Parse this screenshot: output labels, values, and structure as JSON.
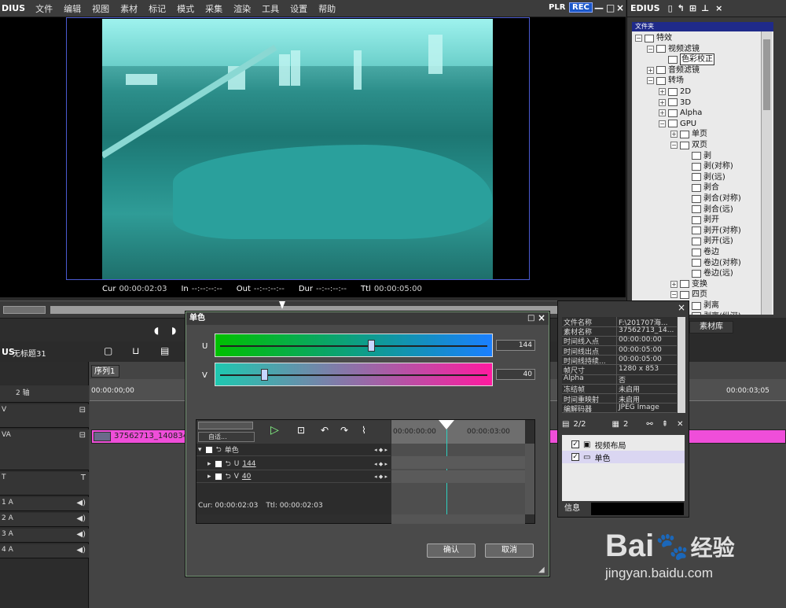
{
  "menu": {
    "logo": "DIUS",
    "items": [
      "文件",
      "编辑",
      "视图",
      "素材",
      "标记",
      "模式",
      "采集",
      "渲染",
      "工具",
      "设置",
      "帮助"
    ],
    "plr": "PLR",
    "rec": "REC"
  },
  "preview": {
    "timecodes": [
      {
        "key": "Cur",
        "value": "00:00:02:03"
      },
      {
        "key": "In",
        "value": "--:--:--:--"
      },
      {
        "key": "Out",
        "value": "--:--:--:--"
      },
      {
        "key": "Dur",
        "value": "--:--:--:--"
      },
      {
        "key": "Ttl",
        "value": "00:00:05:00"
      }
    ],
    "video_tint": "#2fa8a3"
  },
  "right_panel": {
    "title": "EDIUS",
    "folder_header": "文件夹",
    "tree": [
      {
        "label": "特效",
        "level": 0,
        "expanded": true
      },
      {
        "label": "视频滤镜",
        "level": 1,
        "expanded": true
      },
      {
        "label": "色彩校正",
        "level": 2,
        "selected": true
      },
      {
        "label": "音频滤镜",
        "level": 1
      },
      {
        "label": "转场",
        "level": 1,
        "expanded": true
      },
      {
        "label": "2D",
        "level": 2
      },
      {
        "label": "3D",
        "level": 2
      },
      {
        "label": "Alpha",
        "level": 2
      },
      {
        "label": "GPU",
        "level": 2,
        "expanded": true
      },
      {
        "label": "单页",
        "level": 3
      },
      {
        "label": "双页",
        "level": 3,
        "expanded": true
      },
      {
        "label": "剥",
        "level": 4
      },
      {
        "label": "剥(对称)",
        "level": 4
      },
      {
        "label": "剥(远)",
        "level": 4
      },
      {
        "label": "剥合",
        "level": 4
      },
      {
        "label": "剥合(对称)",
        "level": 4
      },
      {
        "label": "剥合(远)",
        "level": 4
      },
      {
        "label": "剥开",
        "level": 4
      },
      {
        "label": "剥开(对称)",
        "level": 4
      },
      {
        "label": "剥开(远)",
        "level": 4
      },
      {
        "label": "卷边",
        "level": 4
      },
      {
        "label": "卷边(对称)",
        "level": 4
      },
      {
        "label": "卷边(远)",
        "level": 4
      },
      {
        "label": "变换",
        "level": 3
      },
      {
        "label": "四页",
        "level": 3,
        "expanded": true
      },
      {
        "label": "剥离",
        "level": 4
      },
      {
        "label": "剥离(纵深)",
        "level": 4
      }
    ],
    "tab": "素材库"
  },
  "timeline": {
    "project": "无标题31",
    "sequence_tab": "序列1",
    "ruler": [
      "00:00:00;00",
      "00:00:03;05"
    ],
    "clip_label": "37562713_1408345",
    "tracks": [
      {
        "label": "2 轴"
      },
      {
        "label": "V"
      },
      {
        "label": "VA"
      },
      {
        "label": "T"
      },
      {
        "label": "1 A"
      },
      {
        "label": "2 A"
      },
      {
        "label": "3 A"
      },
      {
        "label": "4 A"
      }
    ]
  },
  "dialog": {
    "title": "单色",
    "u_label": "U",
    "u_value": 144,
    "v_label": "V",
    "v_value": 40,
    "kf_dropdown": "自适...",
    "kf_ruler": [
      "00:00:00:00",
      "00:00:03:00"
    ],
    "kf_rows": [
      {
        "label": "单色"
      },
      {
        "label": "U",
        "value": "144"
      },
      {
        "label": "V",
        "value": "40"
      }
    ],
    "cur_text": "Cur: 00:00:02:03",
    "ttl_text": "Ttl: 00:00:02:03",
    "ok_label": "确认",
    "cancel_label": "取消"
  },
  "info_panel": {
    "rows": [
      {
        "k": "文件名称",
        "v": "F:\\201707海..."
      },
      {
        "k": "素材名称",
        "v": "37562713_14..."
      },
      {
        "k": "时间线入点",
        "v": "00:00:00:00"
      },
      {
        "k": "时间线出点",
        "v": "00:00:05:00"
      },
      {
        "k": "时间线持续...",
        "v": "00:00:05:00"
      },
      {
        "k": "帧尺寸",
        "v": "1280 x 853"
      },
      {
        "k": "Alpha",
        "v": "否"
      },
      {
        "k": "冻结帧",
        "v": "未启用"
      },
      {
        "k": "时间重映射",
        "v": "未启用"
      },
      {
        "k": "编解码器",
        "v": "JPEG Image"
      }
    ],
    "page_count": "2/2",
    "layer_count": "2",
    "effects": [
      {
        "label": "视频布局",
        "checked": true
      },
      {
        "label": "单色",
        "checked": true,
        "selected": true
      }
    ],
    "tab": "信息"
  },
  "watermark": {
    "brand": "Bai",
    "brand2": "经验",
    "url": "jingyan.baidu.com"
  },
  "colors": {
    "accent": "#1b57c8",
    "clip": "#ef4ed9",
    "u_gradient_start": "#00c000",
    "u_gradient_end": "#1a7fff",
    "v_gradient_start": "#1ec8b0",
    "v_gradient_end": "#ff1aa0"
  }
}
